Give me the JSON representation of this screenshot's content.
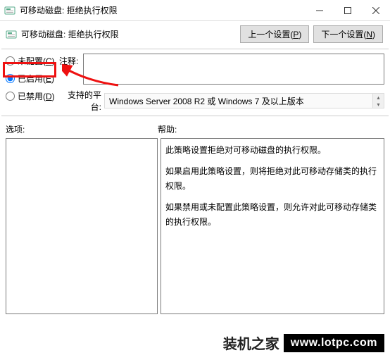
{
  "window": {
    "title": "可移动磁盘: 拒绝执行权限",
    "minimize": "—",
    "maximize": "□",
    "close": "×"
  },
  "header": {
    "title": "可移动磁盘: 拒绝执行权限"
  },
  "nav": {
    "prev": "上一个设置(",
    "prev_key": "P",
    "prev_end": ")",
    "next": "下一个设置(",
    "next_key": "N",
    "next_end": ")"
  },
  "radio": {
    "not_configured": "未配置(",
    "not_configured_key": "C",
    "enabled": "已启用(",
    "enabled_key": "E",
    "disabled": "已禁用(",
    "disabled_key": "D",
    "close_paren": ")"
  },
  "comment": {
    "label": "注释:"
  },
  "platform": {
    "label": "支持的平台:",
    "value": "Windows Server 2008 R2 或 Windows 7 及以上版本"
  },
  "sections": {
    "options": "选项:",
    "help": "帮助:"
  },
  "help_text": {
    "p1": "此策略设置拒绝对可移动磁盘的执行权限。",
    "p2": "如果启用此策略设置，则将拒绝对此可移动存储类的执行权限。",
    "p3": "如果禁用或未配置此策略设置，则允许对此可移动存储类的执行权限。"
  },
  "watermark": {
    "zh": "装机之家",
    "url": "www.lotpc.com"
  },
  "annotation": {
    "highlight_color": "#e11",
    "arrow_color": "#e11"
  }
}
